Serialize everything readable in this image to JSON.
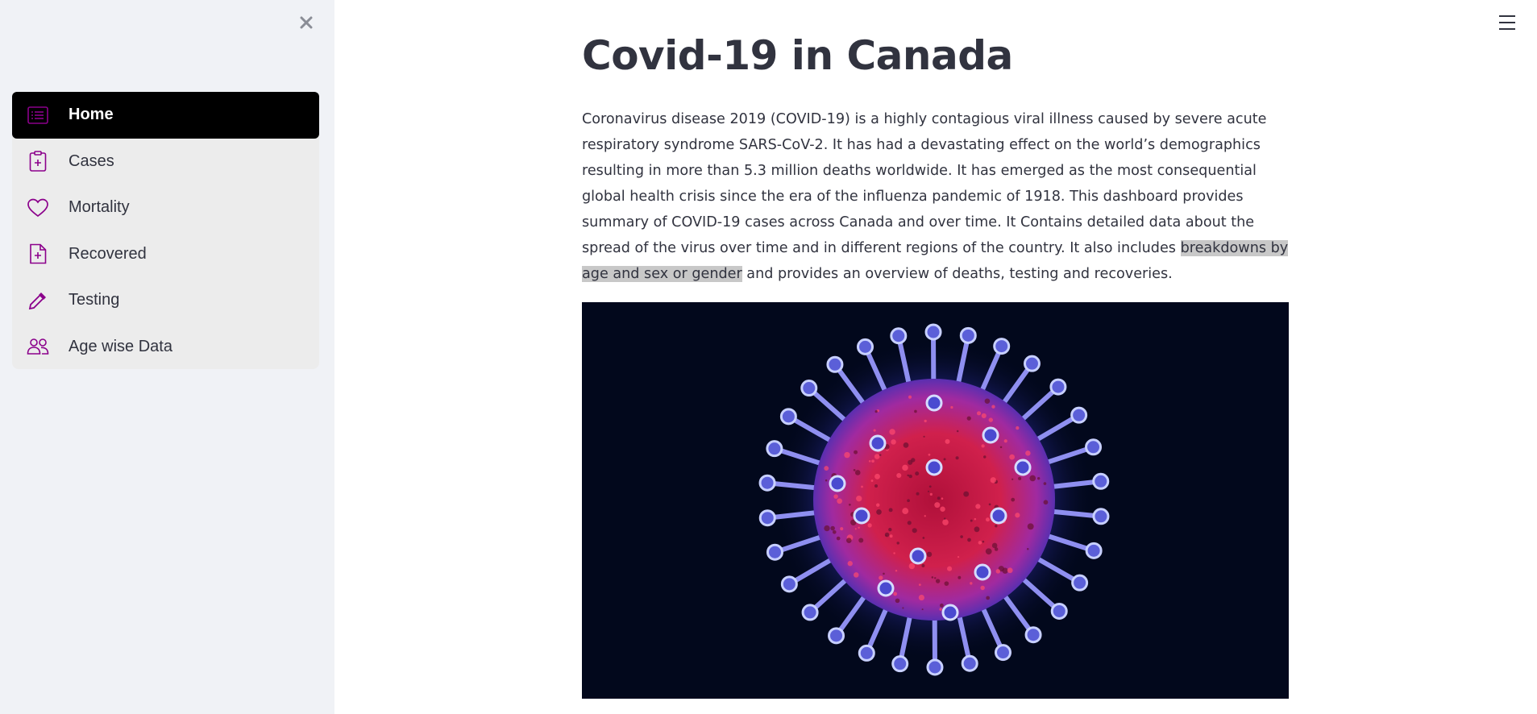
{
  "sidebar": {
    "items": [
      {
        "label": "Home",
        "icon": "list-icon",
        "active": true
      },
      {
        "label": "Cases",
        "icon": "clipboard-plus-icon",
        "active": false
      },
      {
        "label": "Mortality",
        "icon": "heart-icon",
        "active": false
      },
      {
        "label": "Recovered",
        "icon": "file-plus-icon",
        "active": false
      },
      {
        "label": "Testing",
        "icon": "eyedropper-icon",
        "active": false
      },
      {
        "label": "Age wise Data",
        "icon": "people-icon",
        "active": false
      }
    ]
  },
  "main": {
    "title": "Covid-19 in Canada",
    "paragraph_before": "Coronavirus disease 2019 (COVID-19) is a highly contagious viral illness caused by severe acute respiratory syndrome SARS-CoV-2. It has had a devastating effect on the world’s demographics resulting in more than 5.3 million deaths worldwide. It has emerged as the most consequential global health crisis since the era of the influenza pandemic of 1918. This dashboard provides summary of COVID-19 cases across Canada and over time. It Contains detailed data about the spread of the virus over time and in different regions of the country. It also includes ",
    "paragraph_highlight": "breakdowns by age and sex or gender",
    "paragraph_after": " and provides an overview of deaths, testing and recoveries."
  },
  "colors": {
    "accent": "#8b008b",
    "sidebar_bg": "#f0f2f6",
    "menu_bg": "#ececec",
    "active_bg": "#000000",
    "image_bg": "#02081c"
  }
}
